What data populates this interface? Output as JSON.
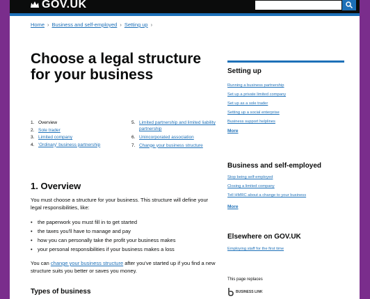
{
  "header": {
    "logo_text": "GOV.UK",
    "search_placeholder": ""
  },
  "breadcrumb": [
    "Home",
    "Business and self-employed",
    "Setting up"
  ],
  "page_title": "Choose a legal structure for your business",
  "toc": {
    "left": [
      {
        "num": "1.",
        "text": "Overview"
      },
      {
        "num": "2.",
        "text": "Sole trader"
      },
      {
        "num": "3.",
        "text": "Limited company"
      },
      {
        "num": "4.",
        "text": "'Ordinary' business partnership"
      }
    ],
    "right": [
      {
        "num": "5.",
        "text": "Limited partnership and limited liability partnership"
      },
      {
        "num": "6.",
        "text": "Unincorporated association"
      },
      {
        "num": "7.",
        "text": "Change your business structure"
      }
    ]
  },
  "overview": {
    "heading": "1. Overview",
    "intro": "You must choose a structure for your business. This structure will define your legal responsibilities, like:",
    "bullets": [
      "the paperwork you must fill in to get started",
      "the taxes you'll have to manage and pay",
      "how you can personally take the profit your business makes",
      "your personal responsibilities if your business makes a loss"
    ],
    "change_before": "You can ",
    "change_link": "change your business structure",
    "change_after": " after you've started up if you find a new structure suits you better or saves you money.",
    "types_heading": "Types of business"
  },
  "sidebar": {
    "setting_up": {
      "heading": "Setting up",
      "links": [
        "Running a business partnership",
        "Set up a private limited company",
        "Set up as a sole trader",
        "Setting up a social enterprise",
        "Business support helplines"
      ],
      "more": "More"
    },
    "business": {
      "heading": "Business and self-employed",
      "links": [
        "Stop being self-employed",
        "Closing a limited company",
        "Tell HMRC about a change to your business"
      ],
      "more": "More"
    },
    "elsewhere": {
      "heading": "Elsewhere on GOV.UK",
      "links": [
        "Employing staff for the first time"
      ]
    },
    "replaces": "This page replaces",
    "replaces_logo": "BUSINESS LINK"
  },
  "colors": {
    "link": "#1d70b8",
    "header_bg": "#0b0c0c",
    "page_bg": "#7a2d8c"
  }
}
